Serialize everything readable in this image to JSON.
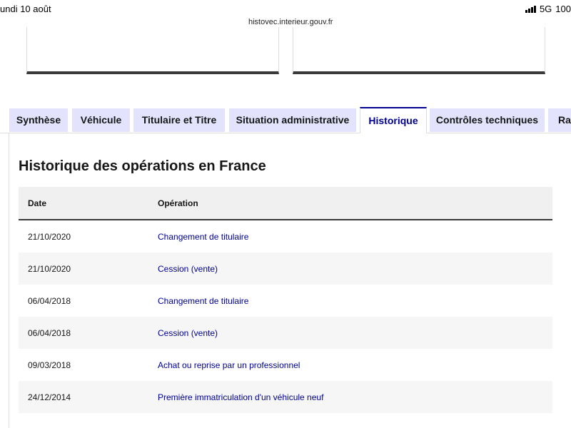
{
  "status_bar": {
    "time": "undi 10 août",
    "network": "5G",
    "battery": "100"
  },
  "browser": {
    "url": "histovec.interieur.gouv.fr"
  },
  "tabs": [
    {
      "label": "Synthèse",
      "active": false
    },
    {
      "label": "Véhicule",
      "active": false
    },
    {
      "label": "Titulaire et Titre",
      "active": false
    },
    {
      "label": "Situation administrative",
      "active": false
    },
    {
      "label": "Historique",
      "active": true
    },
    {
      "label": "Contrôles techniques",
      "active": false
    },
    {
      "label": "Rap",
      "active": false
    }
  ],
  "section": {
    "title": "Historique des opérations en France"
  },
  "table": {
    "headers": {
      "date": "Date",
      "operation": "Opération"
    },
    "rows": [
      {
        "date": "21/10/2020",
        "operation": "Changement de titulaire"
      },
      {
        "date": "21/10/2020",
        "operation": "Cession (vente)"
      },
      {
        "date": "06/04/2018",
        "operation": "Changement de titulaire"
      },
      {
        "date": "06/04/2018",
        "operation": "Cession (vente)"
      },
      {
        "date": "09/03/2018",
        "operation": "Achat ou reprise par un professionnel"
      },
      {
        "date": "24/12/2014",
        "operation": "Première immatriculation d'un véhicule neuf"
      }
    ]
  },
  "colors": {
    "accent": "#000091",
    "tab_background": "#e3e3fd",
    "header_background": "#f0f0f0"
  }
}
